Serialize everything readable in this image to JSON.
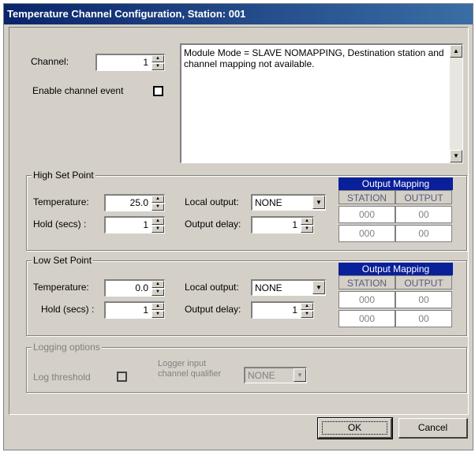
{
  "window": {
    "title": "Temperature Channel Configuration, Station: 001"
  },
  "channel": {
    "label": "Channel:",
    "value": "1"
  },
  "enable_event": {
    "label": "Enable channel event",
    "checked": false
  },
  "message": {
    "text": "Module Mode = SLAVE NOMAPPING, Destination station and channel mapping not available."
  },
  "high": {
    "title": "High Set Point",
    "temperature_label": "Temperature:",
    "temperature": "25.0",
    "hold_label": "Hold (secs) :",
    "hold": "1",
    "local_output_label": "Local output:",
    "local_output": "NONE",
    "output_delay_label": "Output delay:",
    "output_delay": "1",
    "mapping": {
      "title": "Output Mapping",
      "col_station": "STATION",
      "col_output": "OUTPUT",
      "rows": [
        {
          "station": "000",
          "output": "00"
        },
        {
          "station": "000",
          "output": "00"
        }
      ]
    }
  },
  "low": {
    "title": "Low Set Point",
    "temperature_label": "Temperature:",
    "temperature": "0.0",
    "hold_label": "Hold (secs) :",
    "hold": "1",
    "local_output_label": "Local output:",
    "local_output": "NONE",
    "output_delay_label": "Output delay:",
    "output_delay": "1",
    "mapping": {
      "title": "Output Mapping",
      "col_station": "STATION",
      "col_output": "OUTPUT",
      "rows": [
        {
          "station": "000",
          "output": "00"
        },
        {
          "station": "000",
          "output": "00"
        }
      ]
    }
  },
  "logging": {
    "title": "Logging options",
    "threshold_label": "Log threshold",
    "qualifier_label_1": "Logger input",
    "qualifier_label_2": "channel qualifier",
    "qualifier_value": "NONE"
  },
  "buttons": {
    "ok": "OK",
    "cancel": "Cancel"
  },
  "colors": {
    "titlebar": "#0a246a",
    "face": "#d4d0c8",
    "mapping_header": "#0a1f9a"
  }
}
